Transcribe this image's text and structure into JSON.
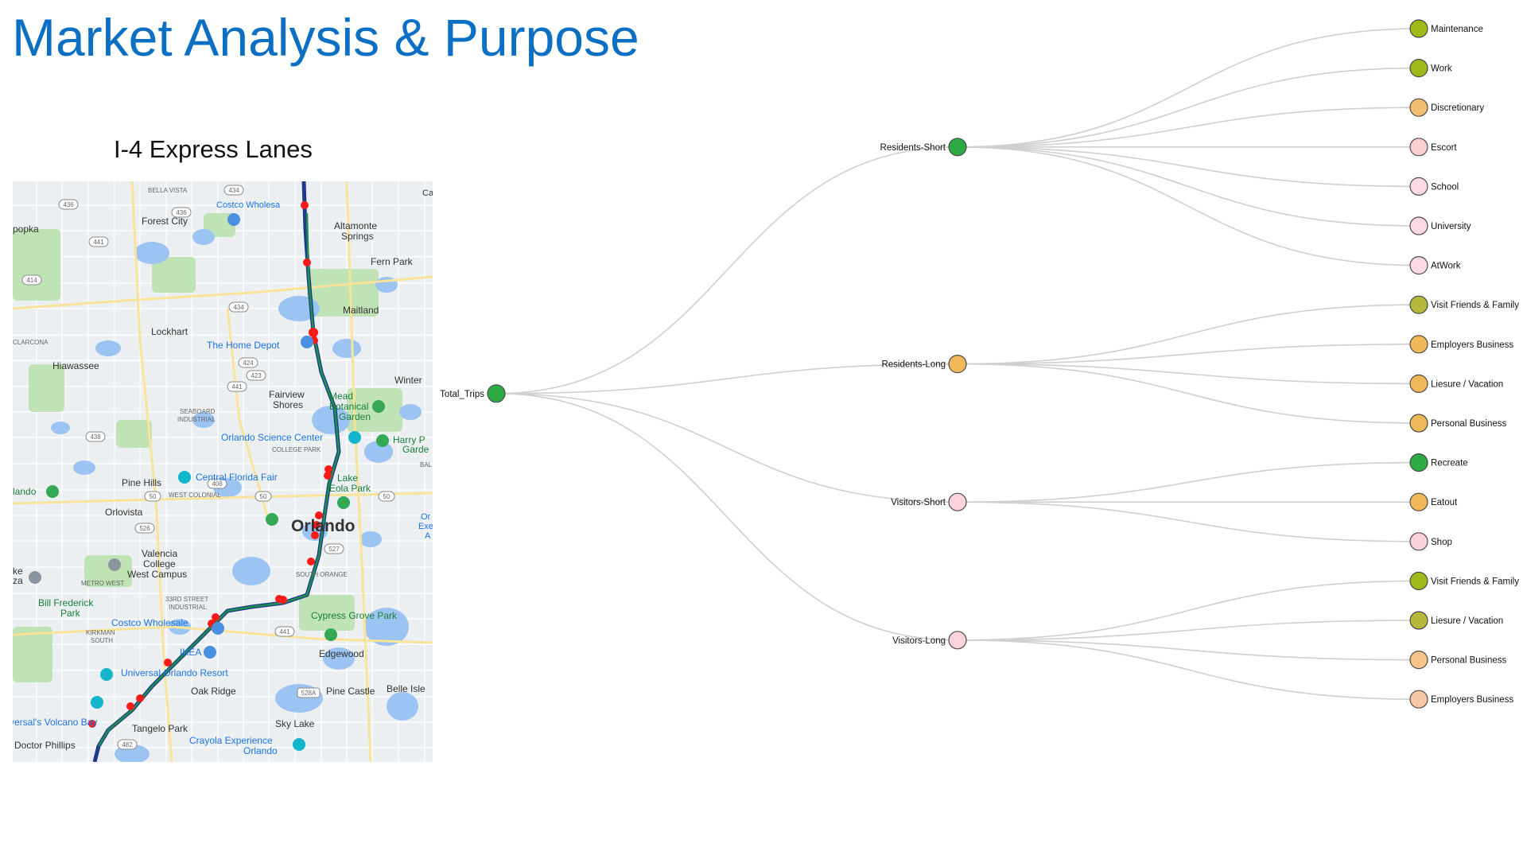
{
  "slide": {
    "title": "Market Analysis & Purpose",
    "map_title": "I-4 Express Lanes"
  },
  "map": {
    "labels": {
      "bella_vista": "BELLA VISTA",
      "costco_north": "Costco Wholesa",
      "forest_city": "Forest City",
      "altamonte": "Altamonte",
      "springs": "Springs",
      "apopka": "Apopka",
      "fern_park": "Fern Park",
      "maitland": "Maitland",
      "lockhart": "Lockhart",
      "clarcona": "CLARCONA",
      "home_depot": "The Home Depot",
      "hiawassee": "Hiawassee",
      "winter": "Winter",
      "fairview": "Fairview",
      "shores": "Shores",
      "mead": "Mead",
      "botanical": "Botanical",
      "garden": "Garden",
      "seaboard": "SEABOARD",
      "industrial": "INDUSTRIAL",
      "science_center": "Orlando Science Center",
      "college_park": "COLLEGE PARK",
      "harry_p": "Harry P",
      "garde": "Garde",
      "bal": "BAL",
      "pine_hills": "Pine Hills",
      "cfl_fair": "Central Florida Fair",
      "lake": "Lake",
      "eola_park": "Eola Park",
      "lando": "lando",
      "west_colonial": "WEST COLONIAL",
      "orlovista": "Orlovista",
      "orlando": "Orlando",
      "or": "Or",
      "exe": "Exe",
      "a": "A",
      "ke": "ke",
      "za": "za",
      "valencia": "Valencia",
      "college": "College",
      "west_campus": "West Campus",
      "south_orange": "SOUTH ORANGE",
      "metro_west": "METRO WEST",
      "bill_frederick": "Bill Frederick",
      "park": "Park",
      "33rd_street": "33RD STREET",
      "industrial2": "INDUSTRIAL",
      "costco_south": "Costco Wholesale",
      "cypress_grove": "Cypress Grove Park",
      "kirkman": "KIRKMAN",
      "south": "SOUTH",
      "ikea": "IKEA",
      "edgewood": "Edgewood",
      "universal_resort": "Universal Orlando Resort",
      "oak_ridge": "Oak Ridge",
      "pine_castle": "Pine Castle",
      "belle_isle": "Belle Isle",
      "volcano_bay": "versal's Volcano Bay",
      "tangelo_park": "Tangelo Park",
      "sky_lake": "Sky Lake",
      "doctor_phillips": "Doctor Phillips",
      "crayola": "Crayola Experience",
      "crayola_orlando": "Orlando",
      "ca": "Ca"
    },
    "shields": {
      "s436a": "436",
      "s434a": "434",
      "s436b": "436",
      "s441a": "441",
      "s414": "414",
      "s434b": "434",
      "s424": "424",
      "s423": "423",
      "s441b": "441",
      "s438": "438",
      "s50a": "50",
      "s408": "408",
      "s50b": "50",
      "s526": "526",
      "s50c": "50",
      "s527": "527",
      "s441c": "441",
      "s528a": "528A",
      "s482": "482"
    },
    "colors": {
      "land": "#eceff1",
      "water": "#9cc4f2",
      "park": "#bfe3b4",
      "road": "#ffffff",
      "major_road": "#f8e39a",
      "corridor": "#1f3a8a",
      "express": "#1e8f4e",
      "interchange": "#ff1a1a"
    }
  },
  "chart_data": {
    "type": "tree",
    "root": "Total_Trips",
    "nodes": [
      {
        "id": "total",
        "label": "Total_Trips",
        "color": "#2eab45"
      },
      {
        "id": "rs",
        "label": "Residents-Short",
        "color": "#2eab45",
        "parent": "total"
      },
      {
        "id": "rl",
        "label": "Residents-Long",
        "color": "#f2b95a",
        "parent": "total"
      },
      {
        "id": "vs",
        "label": "Visitors-Short",
        "color": "#fcd3dc",
        "parent": "total"
      },
      {
        "id": "vl",
        "label": "Visitors-Long",
        "color": "#fcd3dc",
        "parent": "total"
      },
      {
        "id": "rs1",
        "label": "Maintenance",
        "color": "#9fb91a",
        "parent": "rs"
      },
      {
        "id": "rs2",
        "label": "Work",
        "color": "#9fb91a",
        "parent": "rs"
      },
      {
        "id": "rs3",
        "label": "Discretionary",
        "color": "#f4be72",
        "parent": "rs"
      },
      {
        "id": "rs4",
        "label": "Escort",
        "color": "#fbcfd2",
        "parent": "rs"
      },
      {
        "id": "rs5",
        "label": "School",
        "color": "#fcd9e3",
        "parent": "rs"
      },
      {
        "id": "rs6",
        "label": "University",
        "color": "#fcd9e3",
        "parent": "rs"
      },
      {
        "id": "rs7",
        "label": "AtWork",
        "color": "#fcd9e3",
        "parent": "rs"
      },
      {
        "id": "rl1",
        "label": "Visit Friends & Family",
        "color": "#b5b83a",
        "parent": "rl"
      },
      {
        "id": "rl2",
        "label": "Employers Business",
        "color": "#efb858",
        "parent": "rl"
      },
      {
        "id": "rl3",
        "label": "Liesure / Vacation",
        "color": "#efb858",
        "parent": "rl"
      },
      {
        "id": "rl4",
        "label": "Personal Business",
        "color": "#efb858",
        "parent": "rl"
      },
      {
        "id": "vs1",
        "label": "Recreate",
        "color": "#2eab45",
        "parent": "vs"
      },
      {
        "id": "vs2",
        "label": "Eatout",
        "color": "#f2b95a",
        "parent": "vs"
      },
      {
        "id": "vs3",
        "label": "Shop",
        "color": "#fcd3dc",
        "parent": "vs"
      },
      {
        "id": "vl1",
        "label": "Visit Friends & Family",
        "color": "#9fb91a",
        "parent": "vl"
      },
      {
        "id": "vl2",
        "label": "Liesure / Vacation",
        "color": "#b5b83a",
        "parent": "vl"
      },
      {
        "id": "vl3",
        "label": "Personal Business",
        "color": "#f7c48a",
        "parent": "vl"
      },
      {
        "id": "vl4",
        "label": "Employers Business",
        "color": "#f7c8a8",
        "parent": "vl"
      }
    ],
    "link_color": "#cfcfcf"
  }
}
